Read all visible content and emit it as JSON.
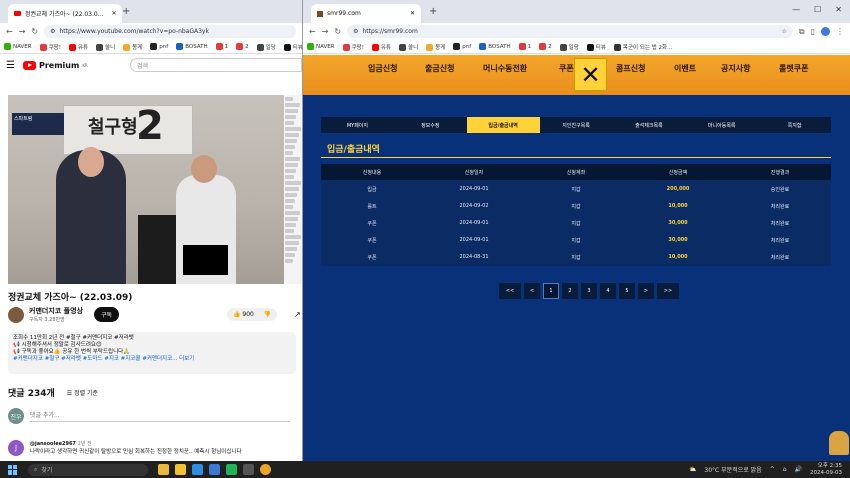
{
  "left": {
    "tab_title": "정권교체 가즈아~ (22.03.0...",
    "url": "https://www.youtube.com/watch?v=po-nbaGA3yk",
    "bookmarks": [
      "NAVER",
      "쿠팡!",
      "유튜",
      "쏠니",
      "몽게",
      "pnf",
      "BOSATH",
      "1",
      "2",
      "일당",
      "티뷰"
    ],
    "yt_logo": "Premium",
    "yt_logo_sup": "KR",
    "search_placeholder": "검색",
    "video_panel_text": "철구형",
    "video_panel_num": "2",
    "video_badge": "스파트림",
    "video_title": "정권교체 가즈아~ (22.03.09)",
    "channel_name": "커맨더지코 풀영상",
    "channel_subs": "구독자 3.28만명",
    "subscribe": "구독",
    "likes": "900",
    "desc_line1": "조회수 11만회 2년 전 #철구 #커맨더지코 #저라뱃",
    "desc_line2": "📢 시청해주셔서 정말로 감사드려요😊",
    "desc_line3": "📢 구독과 좋아요👍 공유 한 번씩 부탁드립니다🙏",
    "desc_tags": "#커맨더지코 #철구 #저라뱃 #도마드 #지코 #지코콜 #커맨더지코... 더보기",
    "comments_count": "댓글 234개",
    "sort_label": "정렬 기준",
    "my_avatar": "진우",
    "add_comment": "댓글 추가...",
    "commenter_initial": "J",
    "commenter": "@jansoolee2967",
    "comment_time": "2년 전",
    "comment_text": "나락이라고 생각하면 귀신같이 탈방으로 민심 회복하는 진정한 정치꾼.. 예측시 헝님이십니다"
  },
  "right": {
    "tab_title": "smr99.com",
    "url": "https://smr99.com",
    "bookmarks": [
      "NAVER",
      "쿠팡!",
      "유튜",
      "쏠니",
      "몽게",
      "pnf",
      "BOSATH",
      "1",
      "2",
      "일당",
      "티뷰",
      "목군이 되는 법 2화..."
    ],
    "nav": [
      "입금신청",
      "출금신청",
      "머니수동전환",
      "쿠폰",
      "콤프신청",
      "이벤트",
      "공지사항",
      "롤렛쿠폰"
    ],
    "close_glyph": "✕",
    "my_tabs": [
      "MY페이지",
      "정보수정",
      "입금/출금내역",
      "지인친구목록",
      "출석체크목록",
      "마니아등목록",
      "쪽지함"
    ],
    "active_tab": "입금/출금내역",
    "section_title": "입금/출금내역",
    "table_headers": [
      "신청내용",
      "신청일자",
      "신청계좌",
      "신청금액",
      "진행결과"
    ],
    "rows": [
      [
        "입금",
        "2024-09-01",
        "지갑",
        "200,000",
        "승인완료"
      ],
      [
        "롤트",
        "2024-09-02",
        "지갑",
        "10,000",
        "처리완료"
      ],
      [
        "쿠폰",
        "2024-09-01",
        "지갑",
        "30,000",
        "처리완료"
      ],
      [
        "쿠폰",
        "2024-09-01",
        "지갑",
        "30,000",
        "처리완료"
      ],
      [
        "쿠폰",
        "2024-08-31",
        "지갑",
        "10,000",
        "처리완료"
      ]
    ],
    "pager": [
      "<<",
      "<",
      "1",
      "2",
      "3",
      "4",
      "5",
      ">",
      ">>"
    ],
    "current_page": "1"
  },
  "taskbar": {
    "search": "찾기",
    "weather": "30°C 부분적으로 맑음",
    "time": "오후 2:35",
    "date": "2024-09-03"
  }
}
